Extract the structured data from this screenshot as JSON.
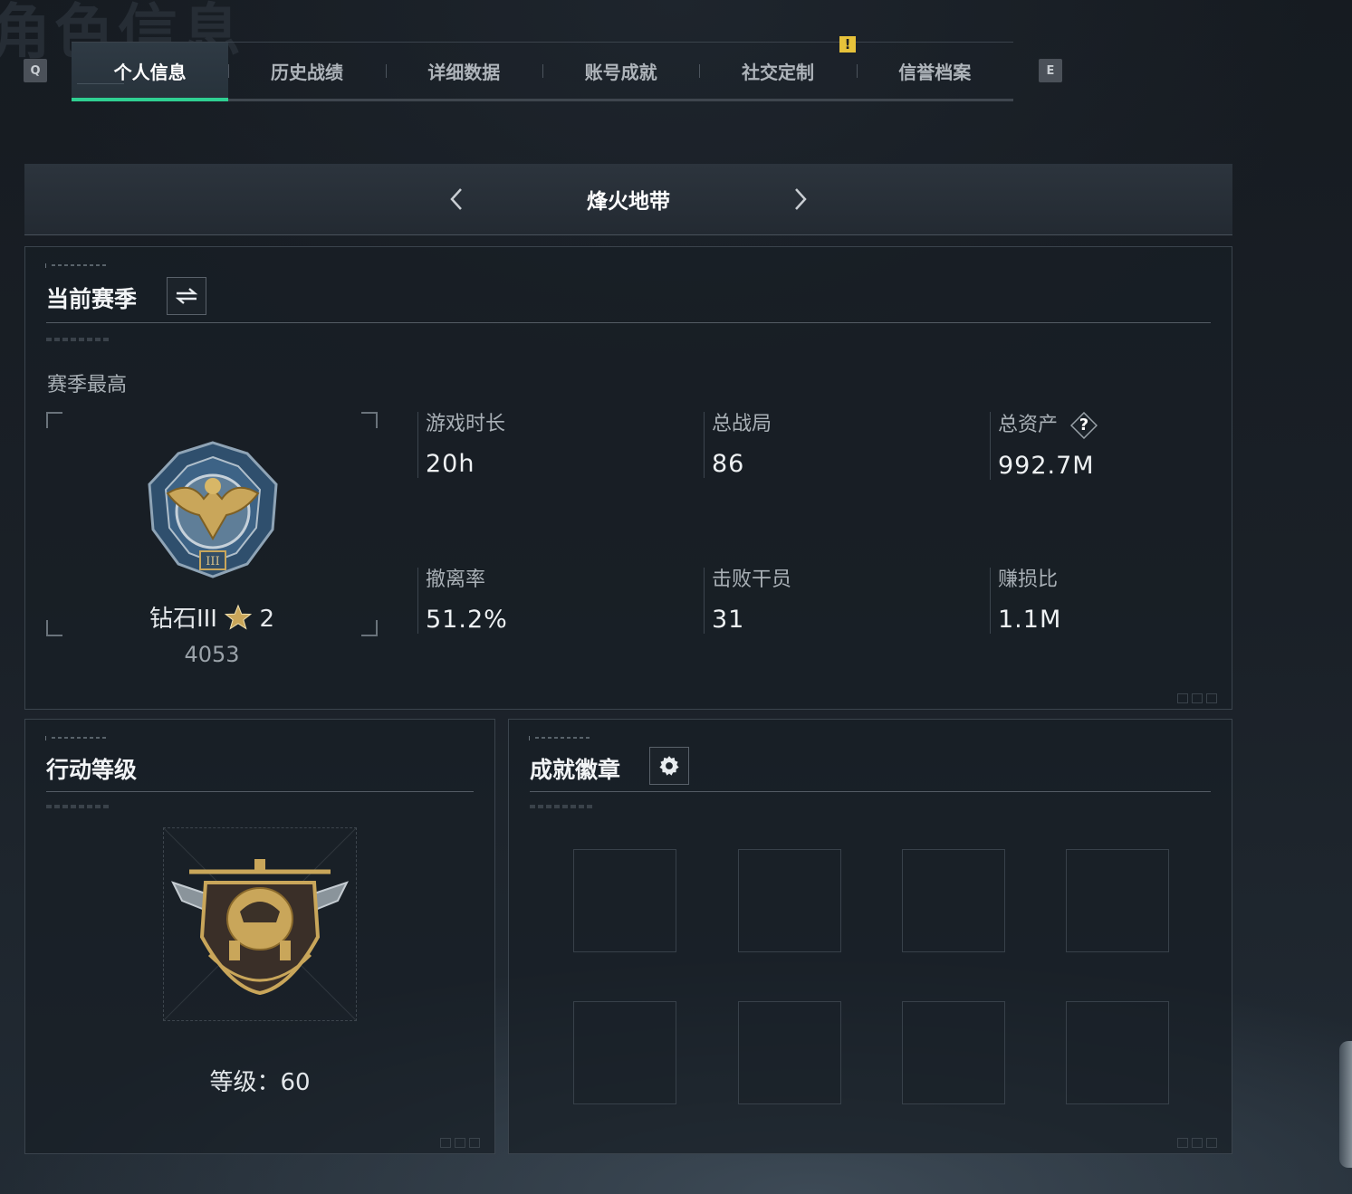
{
  "header": {
    "bg_title": "角色信息",
    "tabs": [
      {
        "label": "个人信息",
        "active": true
      },
      {
        "label": "历史战绩"
      },
      {
        "label": "详细数据"
      },
      {
        "label": "账号成就"
      },
      {
        "label": "社交定制"
      },
      {
        "label": "信誉档案"
      }
    ],
    "key_prev": "Q",
    "key_next": "E",
    "notice_badge": "!"
  },
  "mode_selector": {
    "current_mode": "烽火地带",
    "prev_icon": "chevron-left-icon",
    "next_icon": "chevron-right-icon"
  },
  "season": {
    "title": "当前赛季",
    "switch_icon": "swap-icon",
    "best_label": "赛季最高",
    "rank_name": "钻石III",
    "rank_stars": "2",
    "rank_score": "4053",
    "stats": [
      {
        "label": "游戏时长",
        "value": "20h"
      },
      {
        "label": "总战局",
        "value": "86"
      },
      {
        "label": "总资产",
        "value": "992.7M",
        "help": "?"
      },
      {
        "label": "撤离率",
        "value": "51.2%"
      },
      {
        "label": "击败干员",
        "value": "31"
      },
      {
        "label": "赚损比",
        "value": "1.1M"
      }
    ]
  },
  "level_panel": {
    "title": "行动等级",
    "level_text": "等级：60"
  },
  "badges_panel": {
    "title": "成就徽章",
    "settings_icon": "gear-icon",
    "slot_count": 8
  },
  "colors": {
    "accent": "#2fcf92",
    "warning": "#e7c23a",
    "gold": "#c9a65a"
  }
}
